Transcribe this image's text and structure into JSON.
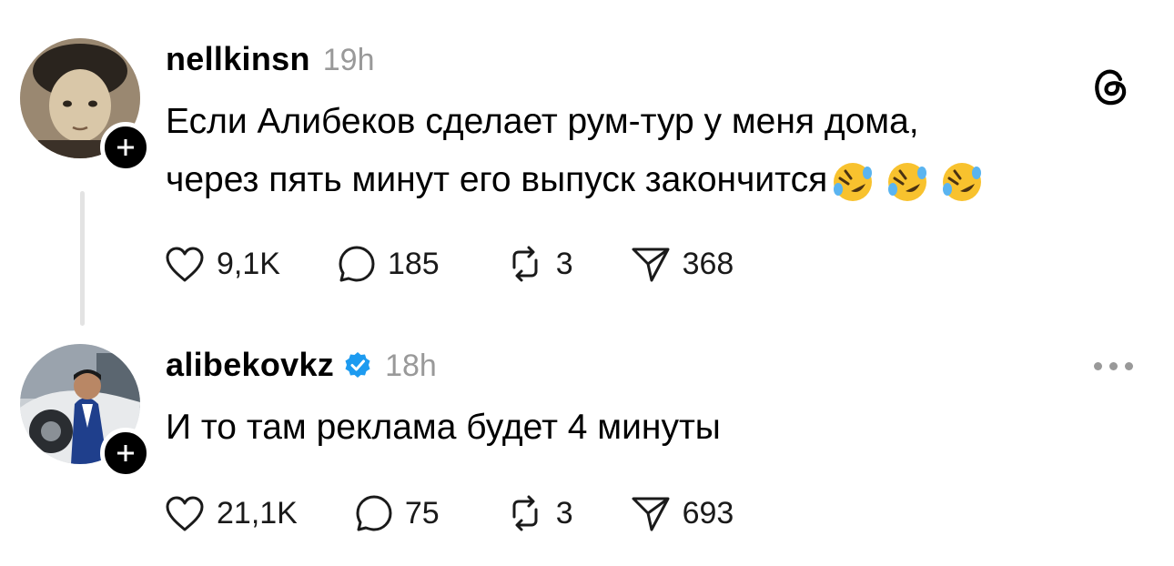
{
  "posts": [
    {
      "username": "nellkinsn",
      "time": "19h",
      "text_line1": "Если Алибеков сделает рум-тур у меня дома,",
      "text_line2": "через пять минут его выпуск закончится",
      "emojis": [
        "rofl-emoji",
        "rofl-emoji",
        "rofl-emoji"
      ],
      "likes": "9,1K",
      "replies": "185",
      "reposts": "3",
      "shares": "368"
    },
    {
      "username": "alibekovkz",
      "verified": true,
      "time": "18h",
      "text": "И то там реклама будет 4 минуты",
      "likes": "21,1K",
      "replies": "75",
      "reposts": "3",
      "shares": "693"
    }
  ],
  "icons": {
    "like": "heart-icon",
    "reply": "speech-bubble-icon",
    "repost": "repost-icon",
    "share": "paper-plane-icon",
    "follow": "plus-icon",
    "app": "threads-logo-icon",
    "menu": "more-dots-icon"
  },
  "colors": {
    "verified": "#1d9bf0",
    "secondary_text": "#999999",
    "emoji": "#f8c22e"
  }
}
